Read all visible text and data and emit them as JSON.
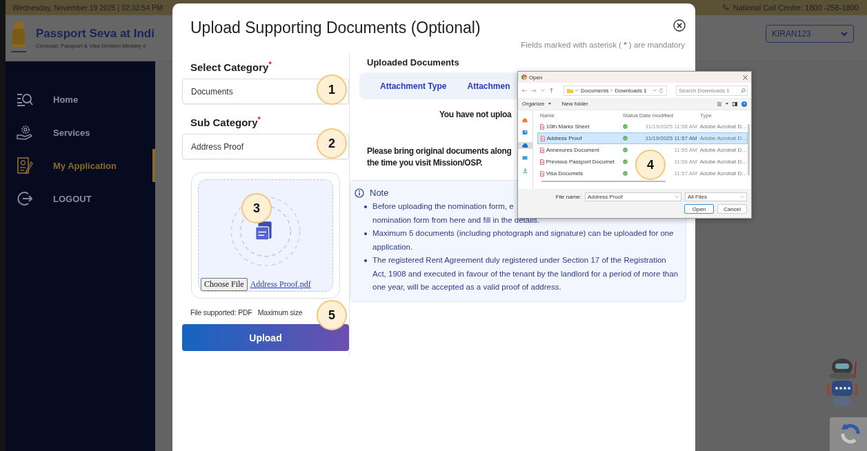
{
  "top_bar": {
    "datetime": "Wednesday, November 19 2025 | 02:33:54 PM",
    "call_centre": "National Call Centre: 1800 -258-1800"
  },
  "header": {
    "title": "Passport Seva at Indi",
    "subtitle": "Consular, Passport & Visa Division Ministry o",
    "user": "KIRAN123"
  },
  "sidebar": {
    "items": [
      {
        "label": "Home",
        "selected": false
      },
      {
        "label": "Services",
        "selected": false
      },
      {
        "label": "My Application",
        "selected": true
      },
      {
        "label": "LOGOUT",
        "selected": false
      }
    ]
  },
  "modal": {
    "title": "Upload Supporting Documents (Optional)",
    "mandatory_note": {
      "before": "Fields marked with asterisk (",
      "mark": "*",
      "after": ") are mandatory"
    },
    "category_label": "Select Category$^{*}$",
    "category_value": "Documents",
    "subcategory_label": "Sub Category$^{*}$",
    "subcategory_value": "Address Proof",
    "choose_button": "Choose File",
    "file_link": "Address Proof.pdf",
    "file_info": "File supported: PDF   Maximum size",
    "upload_button": "Upload",
    "uploaded_heading": "Uploaded Documents",
    "table_columns": [
      "Attachment Type",
      "Attachmen"
    ],
    "empty_message": "You have not uploa",
    "reminder": "Please bring original documents along\nthe time you visit Mission/OSP.",
    "note": {
      "title": "Note",
      "items": [
        "Before uploading the nomination form, e\nnomination form from here and fill in the details.",
        "Maximum 5 documents (including photograph and signature) can be uploaded for one application.",
        "The registered Rent Agreement duly registered under Section 17 of the Registration Act, 1908 and executed in favour of the tenant by the landlord for a period of more than one year, will be accepted as a valid proof of address."
      ]
    }
  },
  "file_dialog": {
    "title": "Open",
    "path": [
      "Documents",
      "Downloads 1"
    ],
    "search_placeholder": "Search Downloads 1",
    "toolbar": [
      "Organize",
      "New folder"
    ],
    "columns": [
      "Name",
      "Status",
      "Date modified",
      "Type"
    ],
    "files": [
      {
        "name": "10th Marks Sheet",
        "date": "11/19/2025 11:58 AM",
        "type": "Adobe Acrobat D…",
        "selected": false
      },
      {
        "name": "Address Proof",
        "date": "11/19/2025 11:57 AM",
        "type": "Adobe Acrobat D…",
        "selected": true
      },
      {
        "name": "Annexures Document",
        "date": "11:55 AM",
        "type": "Adobe Acrobat D…",
        "selected": false
      },
      {
        "name": "Previous Passport Documet",
        "date": "11:56 AM",
        "type": "Adobe Acrobat D…",
        "selected": false
      },
      {
        "name": "Visa Documets",
        "date": "11:57 AM",
        "type": "Adobe Acrobat D…",
        "selected": false
      }
    ],
    "file_name_label": "File name:",
    "file_name": "Address Proof",
    "file_type": "All Files",
    "buttons": [
      {
        "label": "Open",
        "default": true
      },
      {
        "label": "Cancel",
        "default": false
      }
    ]
  },
  "callouts": [
    "1",
    "2",
    "3",
    "4",
    "5"
  ]
}
